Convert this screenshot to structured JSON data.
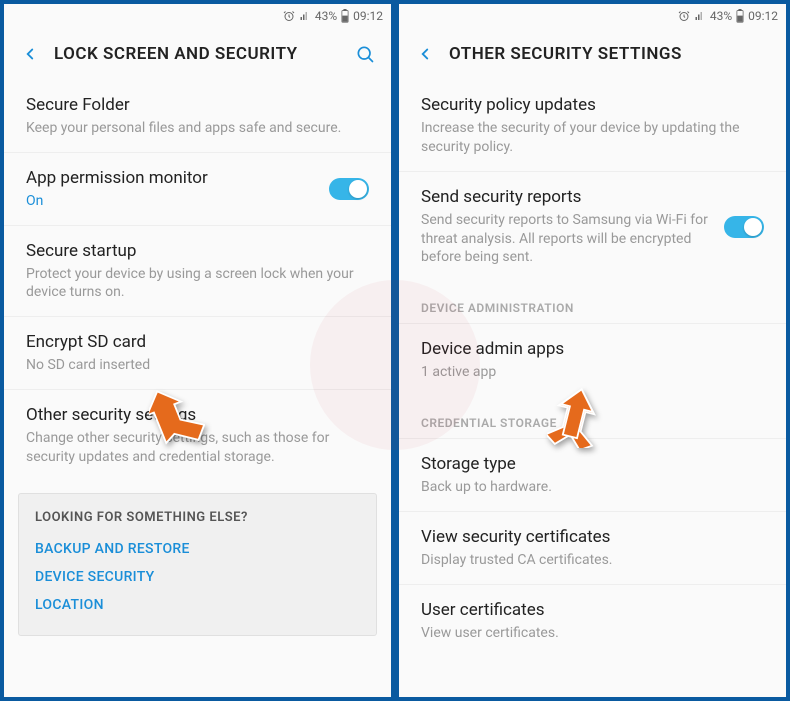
{
  "statusbar": {
    "battery_pct": "43%",
    "time": "09:12"
  },
  "left": {
    "title": "LOCK SCREEN AND SECURITY",
    "items": {
      "secureFolder": {
        "title": "Secure Folder",
        "sub": "Keep your personal files and apps safe and secure."
      },
      "appPerm": {
        "title": "App permission monitor",
        "sub": "On"
      },
      "secureStartup": {
        "title": "Secure startup",
        "sub": "Protect your device by using a screen lock when your device turns on."
      },
      "encryptSd": {
        "title": "Encrypt SD card",
        "sub": "No SD card inserted"
      },
      "otherSec": {
        "title": "Other security settings",
        "sub": "Change other security settings, such as those for security updates and credential storage."
      }
    },
    "card": {
      "heading": "LOOKING FOR SOMETHING ELSE?",
      "links": [
        "BACKUP AND RESTORE",
        "DEVICE SECURITY",
        "LOCATION"
      ]
    }
  },
  "right": {
    "title": "OTHER SECURITY SETTINGS",
    "items": {
      "policy": {
        "title": "Security policy updates",
        "sub": "Increase the security of your device by updating the security policy."
      },
      "reports": {
        "title": "Send security reports",
        "sub": "Send security reports to Samsung via Wi-Fi for threat analysis. All reports will be encrypted before being sent."
      },
      "deviceAdminSection": "DEVICE ADMINISTRATION",
      "deviceAdmin": {
        "title": "Device admin apps",
        "sub": "1 active app"
      },
      "credSection": "CREDENTIAL STORAGE",
      "storageType": {
        "title": "Storage type",
        "sub": "Back up to hardware."
      },
      "viewCerts": {
        "title": "View security certificates",
        "sub": "Display trusted CA certificates."
      },
      "userCerts": {
        "title": "User certificates",
        "sub": "View user certificates."
      }
    }
  }
}
